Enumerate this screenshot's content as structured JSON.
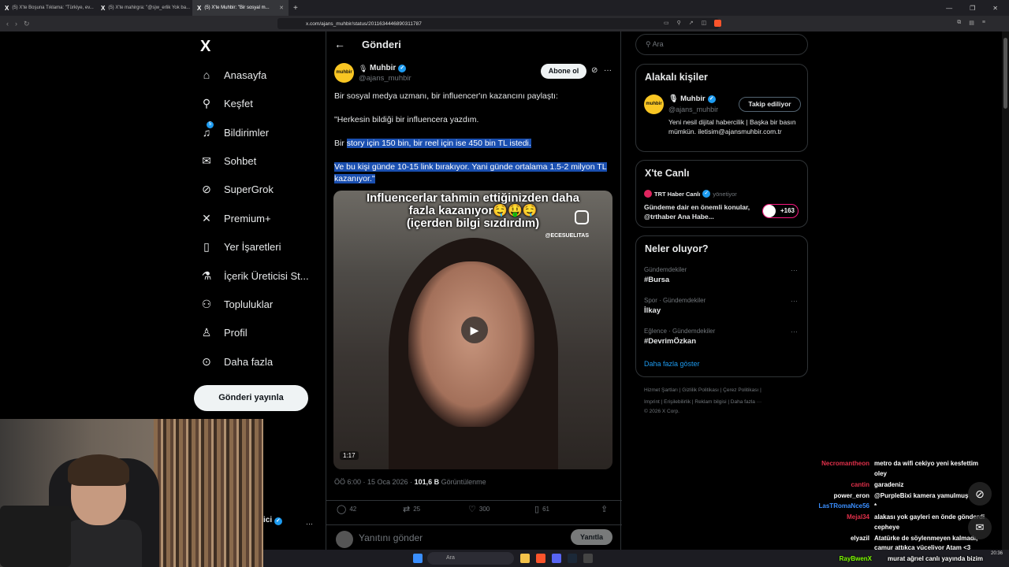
{
  "browser": {
    "tabs": [
      {
        "title": "(5) X'te Boşuna Tıklama: \"Türkiye, ev...",
        "active": false
      },
      {
        "title": "(5) X'te mahirgra: \"@sjw_erlik Yok ba...",
        "active": false
      },
      {
        "title": "(5) X'te Muhbir: \"Bir sosyal m...",
        "active": true
      }
    ],
    "new_tab": "+",
    "url": "x.com/ajans_muhbir/status/2011634446890311787"
  },
  "sidebar": {
    "logo": "X",
    "items": [
      {
        "label": "Anasayfa",
        "icon": "home-icon",
        "glyph": "⌂"
      },
      {
        "label": "Keşfet",
        "icon": "search-icon",
        "glyph": "⚲"
      },
      {
        "label": "Bildirimler",
        "icon": "bell-icon",
        "glyph": "🔔",
        "badge": "5"
      },
      {
        "label": "Sohbet",
        "icon": "mail-icon",
        "glyph": "✉"
      },
      {
        "label": "SuperGrok",
        "icon": "grok-icon",
        "glyph": "⊘"
      },
      {
        "label": "Premium+",
        "icon": "x-icon",
        "glyph": "✕"
      },
      {
        "label": "Yer İşaretleri",
        "icon": "bookmark-icon",
        "glyph": "▯"
      },
      {
        "label": "İçerik Üreticisi St...",
        "icon": "flask-icon",
        "glyph": "⚗"
      },
      {
        "label": "Topluluklar",
        "icon": "community-icon",
        "glyph": "⚇"
      },
      {
        "label": "Profil",
        "icon": "person-icon",
        "glyph": "♙"
      },
      {
        "label": "Daha fazla",
        "icon": "more-icon",
        "glyph": "⊙"
      }
    ],
    "post_button": "Gönderi yayınla",
    "account_name_fragment": "ici"
  },
  "post": {
    "header_title": "Gönderi",
    "author_name": "Muhbir",
    "author_handle": "@ajans_muhbir",
    "avatar_text": "muhbir",
    "subscribe": "Abone ol",
    "text_1": "Bir sosyal medya uzmanı, bir influencer'ın kazancını paylaştı:",
    "text_2": "\"Herkesin bildiği bir influencera yazdım.",
    "text_3_prefix": "Bir ",
    "text_3_highlight": "story için 150 bin, bir reel için ise 450 bin TL istedi.",
    "text_4": "Ve bu kişi günde 10-15 link bırakıyor. Yani günde ortalama 1.5-2 milyon TL kazanıyor.\"",
    "media": {
      "overlay_line1": "Influencerlar tahmin ettiğinizden daha",
      "overlay_line2": "fazla kazanıyor🤤🤑🤤",
      "overlay_line3": "(içerden bilgi sızdırdım)",
      "watermark": "@ECESUELITAS",
      "duration": "1:17"
    },
    "time": "ÖÖ 6:00 · 15 Oca 2026 · ",
    "views_count": "101,6 B",
    "views_label": "Görüntülenme",
    "stats": {
      "replies": "42",
      "reposts": "25",
      "likes": "300",
      "bookmarks": "61"
    },
    "reply_placeholder": "Yanıtını gönder",
    "reply_button": "Yanıtla"
  },
  "right": {
    "search_placeholder": "Ara",
    "related": {
      "title": "Alakalı kişiler",
      "name": "Muhbir",
      "handle": "@ajans_muhbir",
      "follow_button": "Takip ediliyor",
      "bio": "Yeni nesil dijital habercilik | Başka bir basın mümkün. iletisim@ajansmuhbir.com.tr"
    },
    "live": {
      "title": "X'te Canlı",
      "channel": "TRT Haber Canlı",
      "role": "yönetiyor",
      "text": "Gündeme dair en önemli konular, @trthaber Ana Habe...",
      "count": "+163"
    },
    "trends": {
      "title": "Neler oluyor?",
      "items": [
        {
          "context": "Gündemdekiler",
          "name": "#Bursa"
        },
        {
          "context": "Spor · Gündemdekiler",
          "name": "İlkay"
        },
        {
          "context": "Eğlence · Gündemdekiler",
          "name": "#DevrimÖzkan"
        }
      ],
      "show_more": "Daha fazla göster"
    },
    "footer_line1": "Hizmet Şartları  |  Gizlilik Politikası  |  Çerez Politikası  |",
    "footer_line2": "Imprint  |  Erişilebilirlik  |  Reklam bilgisi  |  Daha fazla ···",
    "footer_line3": "© 2026 X Corp."
  },
  "chat": [
    {
      "user": "Necromantheon",
      "color": "#e0304a",
      "msg": "metro da wifi cekiyo yeni kesfettim",
      "msg2": "oley"
    },
    {
      "user": "cantin",
      "color": "#e0304a",
      "msg": "garadeniz"
    },
    {
      "user": "power_eron",
      "color": "#ffffff",
      "msg": "@PurpleBixi kamera yamulmuş"
    },
    {
      "user": "LasTRomaNce56",
      "color": "#3a8fff",
      "msg": "*"
    },
    {
      "user": "Mejal34",
      "color": "#e0304a",
      "msg": "alakası yok gayleri en önde gönderdi",
      "msg2": "cepheye"
    },
    {
      "user": "elyazil",
      "color": "#ffffff",
      "msg": "Atatürke de söylenmeyen kalmadı,",
      "msg2": "çamur attıkça yüceliyor Atam <3"
    },
    {
      "user": "RayBwenX",
      "color": "#7fff00",
      "msg": "murat ağrıel canlı yayında bizim"
    }
  ],
  "taskbar": {
    "search": "Ara",
    "time": "20:36"
  }
}
